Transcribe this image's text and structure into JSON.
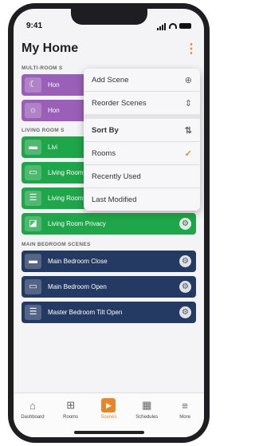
{
  "status": {
    "time": "9:41"
  },
  "header": {
    "title": "My Home"
  },
  "sections": [
    {
      "label": "MULTI-ROOM S",
      "color": "#9a5fb6",
      "items": [
        {
          "name": "Hon",
          "icon": "moon-icon"
        },
        {
          "name": "Hon",
          "icon": "sun-icon"
        }
      ]
    },
    {
      "label": "LIVING ROOM S",
      "color": "#1fa54a",
      "items": [
        {
          "name": "Livi",
          "icon": "shade-closed-icon"
        },
        {
          "name": "Living Room Open",
          "icon": "shade-open-icon"
        },
        {
          "name": "Living Room Tilt Open",
          "icon": "blinds-icon"
        },
        {
          "name": "Living Room Privacy",
          "icon": "privacy-icon"
        }
      ]
    },
    {
      "label": "MAIN BEDROOM SCENES",
      "color": "#253a63",
      "items": [
        {
          "name": "Main Bedroom Close",
          "icon": "shade-closed-icon"
        },
        {
          "name": "Main Bedroom Open",
          "icon": "shade-open-icon"
        },
        {
          "name": "Master Bedroom Tilt Open",
          "icon": "blinds-icon"
        }
      ]
    }
  ],
  "menu": {
    "add_scene": "Add Scene",
    "reorder_scenes": "Reorder Scenes",
    "sort_by": "Sort By",
    "rooms": "Rooms",
    "recently_used": "Recently Used",
    "last_modified": "Last Modified",
    "selected_sort": "Rooms"
  },
  "tabs": [
    {
      "label": "Dashboard",
      "icon": "house-icon",
      "active": false
    },
    {
      "label": "Rooms",
      "icon": "grid-icon",
      "active": false
    },
    {
      "label": "Scenes",
      "icon": "play-icon",
      "active": true
    },
    {
      "label": "Schedules",
      "icon": "calendar-icon",
      "active": false
    },
    {
      "label": "More",
      "icon": "menu-icon",
      "active": false
    }
  ],
  "colors": {
    "accent": "#e8842a"
  }
}
